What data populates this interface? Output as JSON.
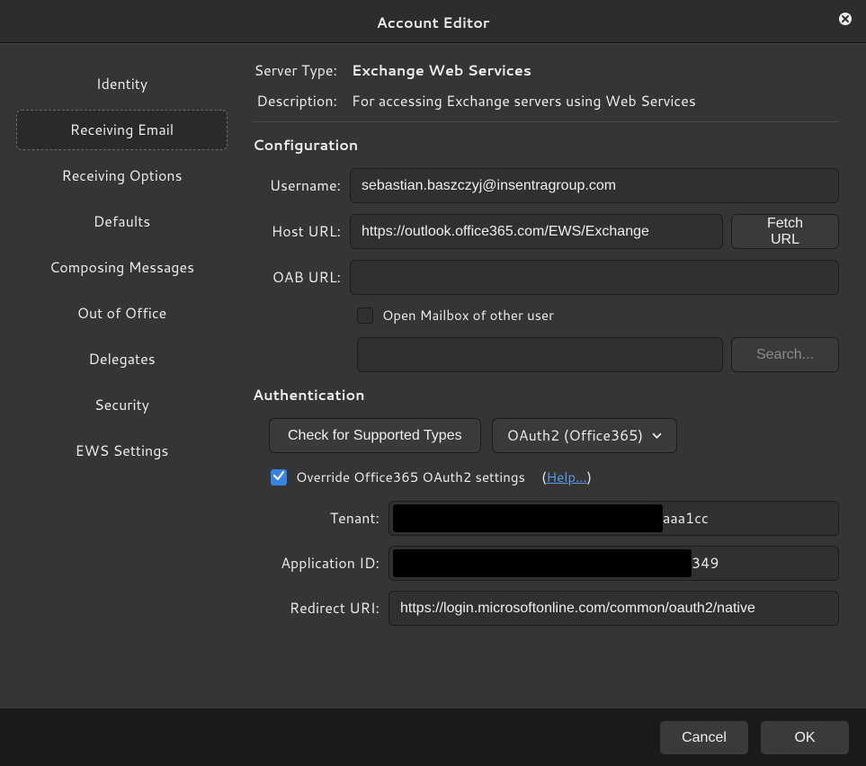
{
  "title": "Account Editor",
  "sidebar": {
    "items": [
      "Identity",
      "Receiving Email",
      "Receiving Options",
      "Defaults",
      "Composing Messages",
      "Out of Office",
      "Delegates",
      "Security",
      "EWS Settings"
    ],
    "selected_index": 1
  },
  "server_type_label": "Server Type:",
  "server_type_value": "Exchange Web Services",
  "description_label": "Description:",
  "description_value": "For accessing Exchange servers using Web Services",
  "config_heading": "Configuration",
  "username_label": "Username:",
  "username_value": "sebastian.baszczyj@insentragroup.com",
  "host_url_label": "Host URL:",
  "host_url_value": "https://outlook.office365.com/EWS/Exchange",
  "fetch_url_label": "Fetch URL",
  "oab_url_label": "OAB URL:",
  "oab_url_value": "",
  "open_mailbox_checkbox_label": "Open Mailbox of other user",
  "open_mailbox_checked": false,
  "search_placeholder": "Search...",
  "search_value": "",
  "auth_heading": "Authentication",
  "check_types_label": "Check for Supported Types",
  "auth_method_label": "OAuth2 (Office365)",
  "override_checked": true,
  "override_label": "Override Office365 OAuth2 settings",
  "help_label": "Help...",
  "tenant_label": "Tenant:",
  "tenant_visible_suffix": "aaa1cc",
  "appid_label": "Application ID:",
  "appid_visible_suffix": "349",
  "redirect_label": "Redirect URI:",
  "redirect_value": "https://login.microsoftonline.com/common/oauth2/native",
  "cancel_label": "Cancel",
  "ok_label": "OK"
}
